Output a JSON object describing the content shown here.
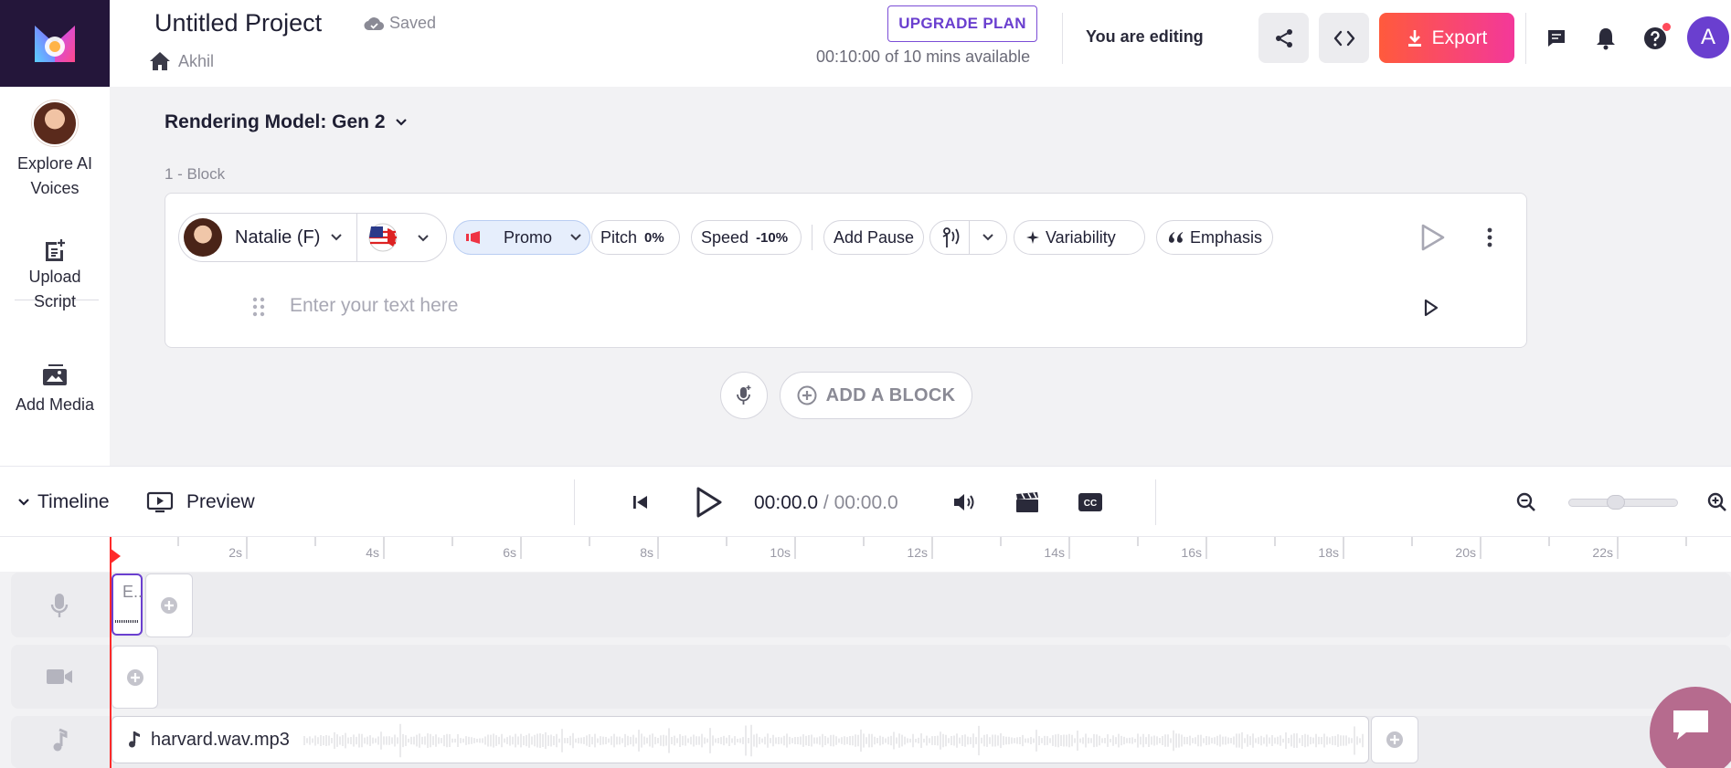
{
  "header": {
    "project_title": "Untitled Project",
    "save_status": "Saved",
    "breadcrumb_user": "Akhil",
    "upgrade_label": "UPGRADE PLAN",
    "minutes_available": "00:10:00 of 10 mins available",
    "editing_status": "You are editing",
    "export_label": "Export",
    "user_initial": "A"
  },
  "sidebar": {
    "items": [
      {
        "label": "Explore AI Voices",
        "icon": "voice-avatar"
      },
      {
        "label": "Upload Script",
        "icon": "script-upload-icon"
      },
      {
        "label": "Add Media",
        "icon": "media-icon"
      }
    ]
  },
  "editor": {
    "rendering_model": "Rendering Model: Gen 2",
    "block_label": "1 -  Block",
    "voice_name": "Natalie (F)",
    "style_label": "Promo",
    "pitch_label": "Pitch",
    "pitch_value": "0%",
    "speed_label": "Speed",
    "speed_value": "-10%",
    "add_pause_label": "Add Pause",
    "variability_label": "Variability",
    "emphasis_label": "Emphasis",
    "text_placeholder": "Enter your text here",
    "add_block_label": "ADD A BLOCK"
  },
  "timeline": {
    "timeline_label": "Timeline",
    "preview_label": "Preview",
    "current_time": "00:00.0",
    "total_time": "/ 00:00.0",
    "ruler_ticks": [
      "2s",
      "4s",
      "6s",
      "8s",
      "10s",
      "12s",
      "14s",
      "16s",
      "18s",
      "20s",
      "22s"
    ],
    "voice_clip_label": "E..",
    "audio_clip_name": "harvard.wav.mp3"
  },
  "colors": {
    "accent": "#6a3fcf",
    "export_gradient_start": "#ff5a3c",
    "export_gradient_end": "#f3389a",
    "playhead": "#ff2a2a",
    "logo_bg": "#24163a"
  }
}
